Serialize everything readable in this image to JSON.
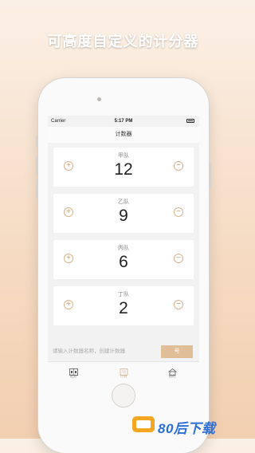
{
  "headline": "可高度自定义的计分器",
  "status_bar": {
    "carrier": "Carrier",
    "time": "5:17 PM"
  },
  "nav": {
    "title": "计数器"
  },
  "teams": [
    {
      "name": "甲队",
      "score": "12"
    },
    {
      "name": "乙队",
      "score": "9"
    },
    {
      "name": "丙队",
      "score": "6"
    },
    {
      "name": "丁队",
      "score": "2"
    }
  ],
  "controls": {
    "plus": "+",
    "minus": "−"
  },
  "input_bar": {
    "placeholder": "请输入计数器名称，创建计数器",
    "button": "号"
  },
  "tabs": [
    {
      "label": "记分",
      "icon": "scoreboard-icon"
    },
    {
      "label": "计数",
      "icon": "counter-icon"
    },
    {
      "label": "我的",
      "icon": "home-icon"
    }
  ],
  "watermark": {
    "text": "80后下载",
    "icon": "cassette-icon"
  },
  "colors": {
    "accent": "#d7b48b",
    "watermark": "#2b6fd6",
    "logo": "#f5a623"
  }
}
